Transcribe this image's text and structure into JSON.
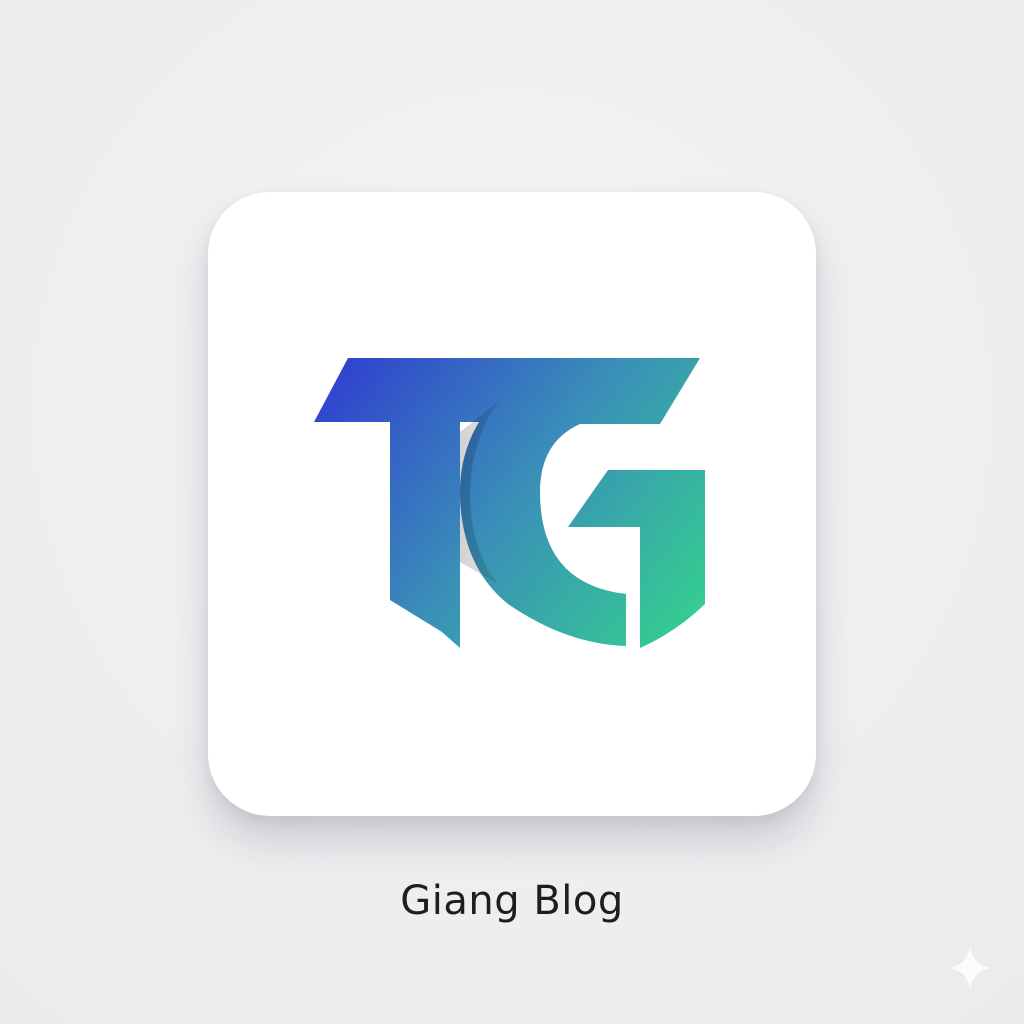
{
  "app": {
    "name": "Giang Blog"
  },
  "icons": {
    "logo": "tg-monogram-logo",
    "corner": "sparkle-icon"
  },
  "colors": {
    "background": "#efeff1",
    "tile": "#ffffff",
    "gradient_start": "#2f3bd0",
    "gradient_mid": "#3a8fb8",
    "gradient_end": "#34d48c",
    "label_text": "#1e1e1e"
  }
}
